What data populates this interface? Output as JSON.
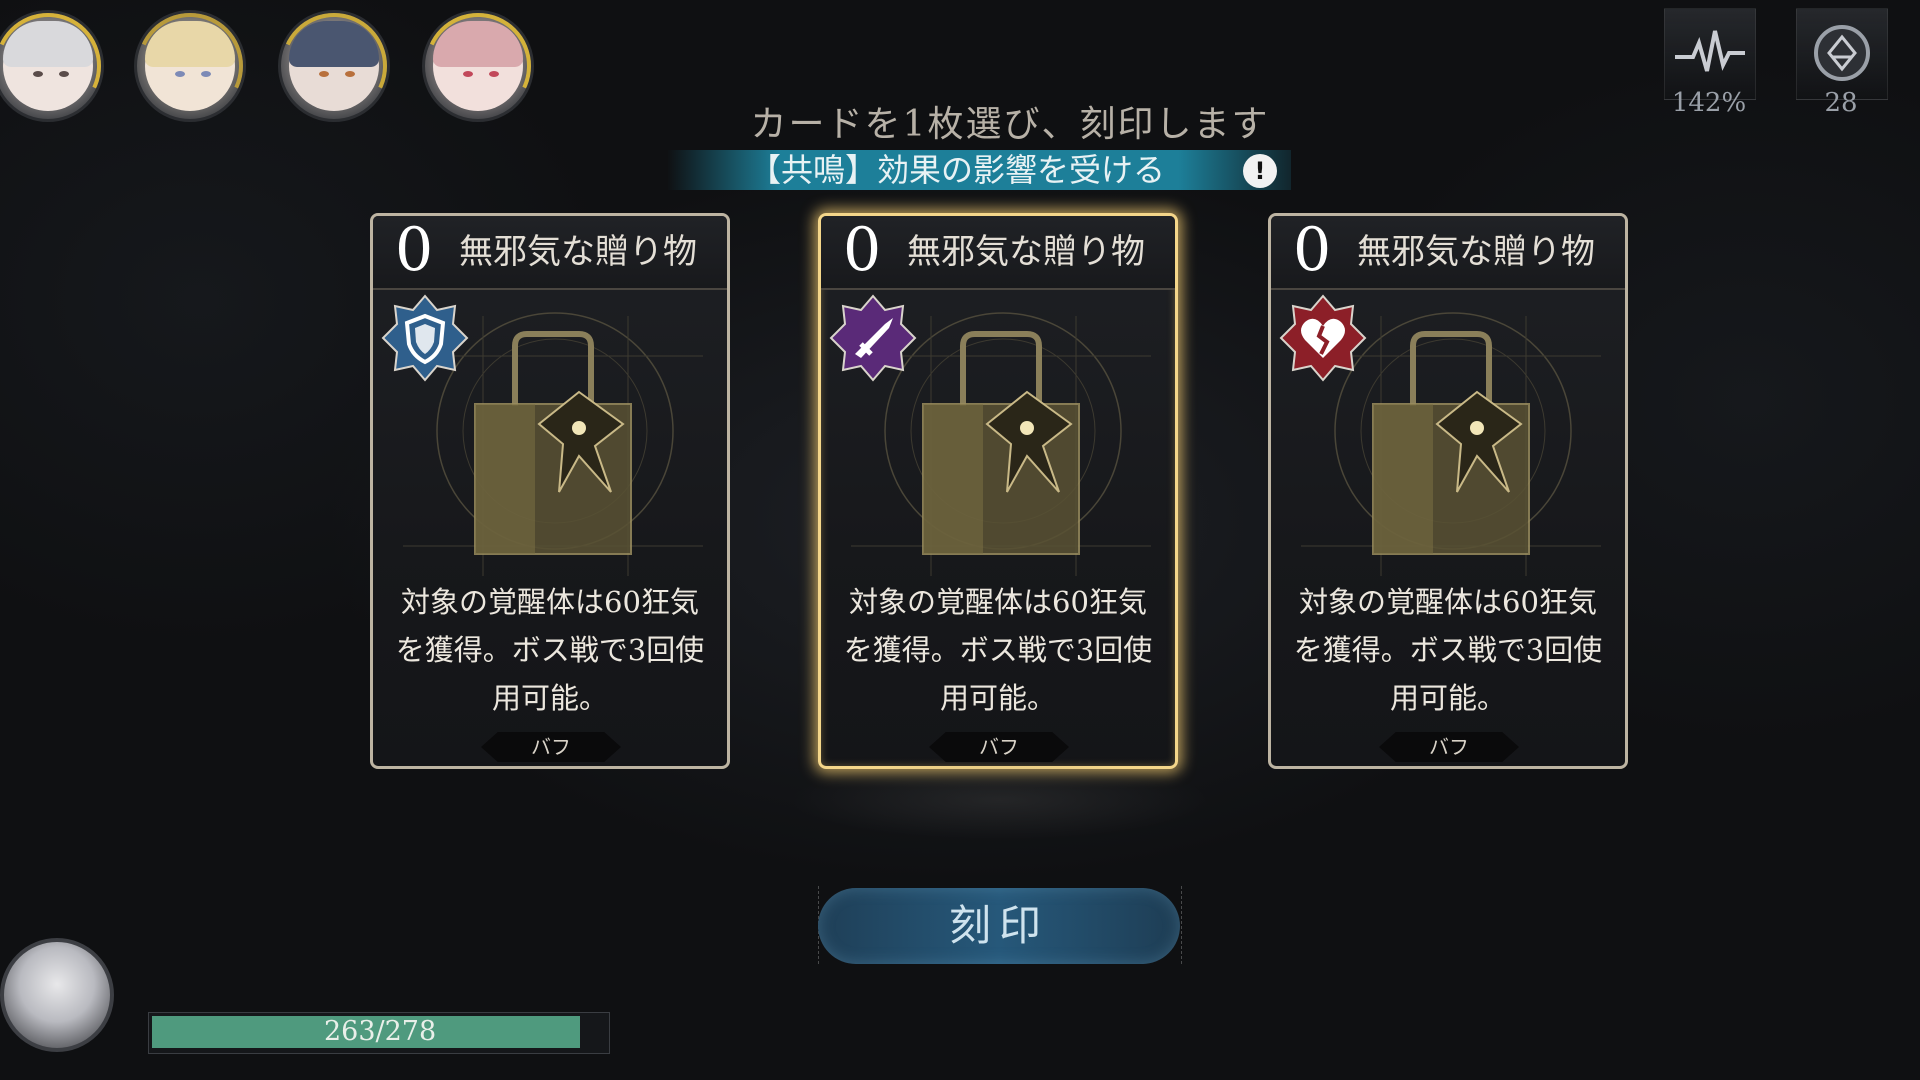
{
  "party": [
    {
      "name": "party-member-1",
      "hair": "#d9d9dc",
      "skin": "#efe4df",
      "eye": "#5a4c4a",
      "ring": "#d6b23a"
    },
    {
      "name": "party-member-2",
      "hair": "#e8d7a8",
      "skin": "#f1e4d6",
      "eye": "#7d8ab6",
      "ring": "#b89a3a"
    },
    {
      "name": "party-member-3",
      "hair": "#4a5670",
      "skin": "#e8dcd6",
      "eye": "#b8703c",
      "ring": "#c9a93a"
    },
    {
      "name": "party-member-4",
      "hair": "#d9a9ad",
      "skin": "#f2e0dc",
      "eye": "#c2485a",
      "ring": "#d4b23a"
    }
  ],
  "stats": {
    "sync_value": "142%",
    "token_value": "28"
  },
  "header": {
    "prompt": "カードを1枚選び、刻印します",
    "resonance": "【共鳴】効果の影響を受ける",
    "info": "!"
  },
  "cards": [
    {
      "cost": "0",
      "name": "無邪気な贈り物",
      "desc": "対象の覚醒体は60狂気を獲得。ボス戦で3回使用可能。",
      "tag": "バフ",
      "emblem_color": "#2f5f8c",
      "emblem_glyph": "shield",
      "selected": false
    },
    {
      "cost": "0",
      "name": "無邪気な贈り物",
      "desc": "対象の覚醒体は60狂気を獲得。ボス戦で3回使用可能。",
      "tag": "バフ",
      "emblem_color": "#5a2a78",
      "emblem_glyph": "dagger",
      "selected": true
    },
    {
      "cost": "0",
      "name": "無邪気な贈り物",
      "desc": "対象の覚醒体は60狂気を獲得。ボス戦で3回使用可能。",
      "tag": "バフ",
      "emblem_color": "#8c1f28",
      "emblem_glyph": "broken-heart",
      "selected": false
    }
  ],
  "imprint_button": "刻印",
  "player": {
    "hp_current": 263,
    "hp_max": 278,
    "hp_text": "263/278",
    "hp_color": "#4f9a7e"
  }
}
